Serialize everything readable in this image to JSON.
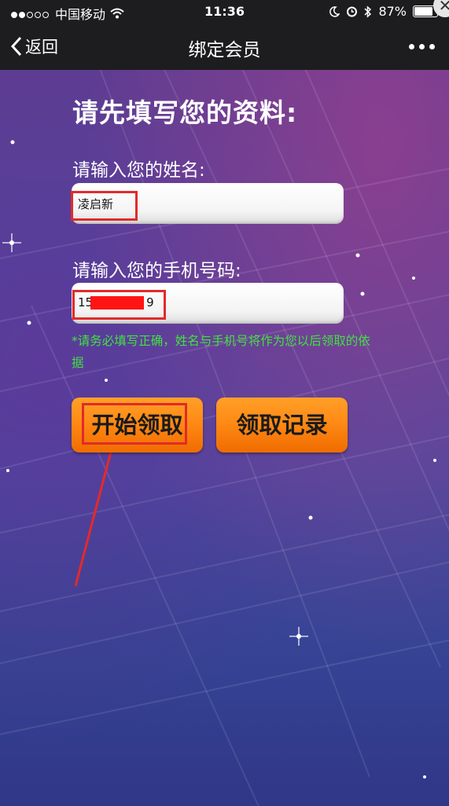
{
  "status_bar": {
    "carrier": "中国移动",
    "time": "11:36",
    "battery": "87%",
    "battery_level": 0.87,
    "icons": [
      "signal-dots-icon",
      "wifi-icon",
      "moon-icon",
      "alarm-icon",
      "bluetooth-icon",
      "battery-icon"
    ]
  },
  "nav": {
    "back_label": "返回",
    "title": "绑定会员",
    "more_icon": "more-dots-icon",
    "close_icon": "close-icon",
    "close_glyph": "✕"
  },
  "form": {
    "heading": "请先填写您的资料:",
    "name_label": "请输入您的姓名:",
    "name_value": "凌启新",
    "phone_label": "请输入您的手机号码:",
    "phone_prefix": "15",
    "phone_suffix": "9",
    "note": "*请务必填写正确，姓名与手机号将作为您以后领取的依据"
  },
  "buttons": {
    "start": "开始领取",
    "records": "领取记录"
  },
  "colors": {
    "accent_orange": "#ff8a15",
    "note_green": "#3fe33f",
    "annotation_red": "#e32a2a"
  }
}
